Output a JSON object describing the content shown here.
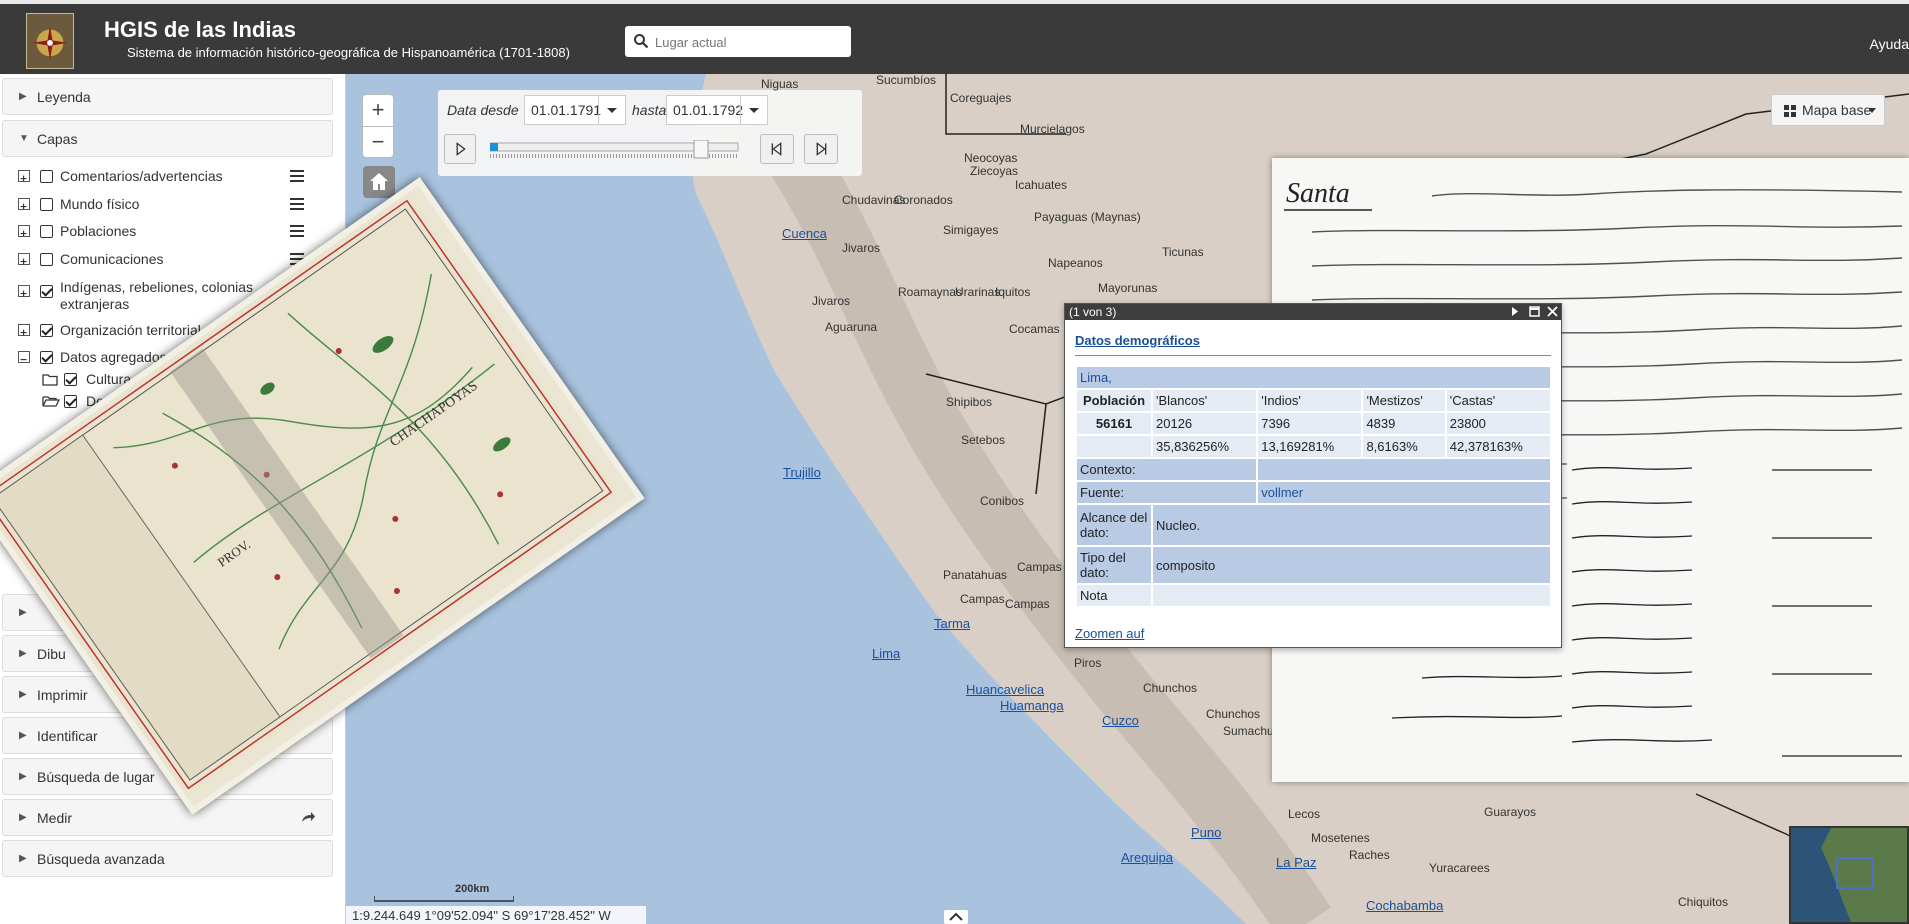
{
  "app": {
    "title": "HGIS de las Indias",
    "subtitle": "Sistema de información histórico-geográfica de Hispanoamérica (1701-1808)",
    "help": "Ayuda"
  },
  "search": {
    "placeholder": "Lugar actual"
  },
  "sidebar": {
    "panels": {
      "legend": "Leyenda",
      "layers": "Capas",
      "identify": "Identificar",
      "place_search": "Búsqueda de lugar",
      "measure": "Medir",
      "advanced_search": "Búsqueda avanzada",
      "draw": "Dibu",
      "print": "Imprimir"
    },
    "layers": [
      {
        "label": "Comentarios/advertencias",
        "checked": false
      },
      {
        "label": "Mundo físico",
        "checked": false
      },
      {
        "label": "Poblaciones",
        "checked": false
      },
      {
        "label": "Comunicaciones",
        "checked": false
      },
      {
        "label": "Indígenas, rebeliones, colonias",
        "label2": "extranjeras",
        "checked": true
      },
      {
        "label": "Organización territorial",
        "checked": true
      },
      {
        "label": "Datos agregados",
        "checked": true
      }
    ],
    "sublayers": [
      {
        "label": "Cultura (grup",
        "checked": true
      },
      {
        "label": "Demog",
        "checked": true
      }
    ]
  },
  "timebar": {
    "from_label": "Data desde",
    "from_value": "01.01.1791",
    "to_label": "hasta",
    "to_value": "01.01.1792"
  },
  "mapbase": {
    "label": "Mapa base"
  },
  "popup": {
    "counter": "(1 von 3)",
    "section": "Datos demográficos",
    "place": "Lima,",
    "headers": [
      "Población",
      "'Blancos'",
      "'Indios'",
      "'Mestizos'",
      "'Castas'"
    ],
    "values": [
      "56161",
      "20126",
      "7396",
      "4839",
      "23800"
    ],
    "percents": [
      "35,836256%",
      "13,169281%",
      "8,6163%",
      "42,378163%"
    ],
    "context_label": "Contexto:",
    "source_label": "Fuente:",
    "source_value": "vollmer",
    "scope_label": "Alcance del dato:",
    "scope_value": "Nucleo.",
    "type_label": "Tipo del dato:",
    "type_value": "composito",
    "note_label": "Nota",
    "zoom_link": "Zoomen auf"
  },
  "map": {
    "scale_label": "200km",
    "coords": "1:9.244.649   1°09'52.094\" S   69°17'28.452\" W",
    "links": [
      "Cuenca",
      "Trujillo",
      "Tarma",
      "Lima",
      "Huancavelica",
      "Huamanga",
      "Cuzco",
      "Puno",
      "Arequipa",
      "La Paz",
      "Cochabamba"
    ],
    "places": [
      "Niguas",
      "Sucumbíos",
      "Coreguajes",
      "Murcielagos",
      "Neocoyas",
      "Ziecoyas",
      "Icahuates",
      "Chudavinas",
      "Coronados",
      "Simigayes",
      "Payaguas (Maynas)",
      "Jivaros",
      "Ticunas",
      "Napeanos",
      "Roamaynas",
      "Urarinas",
      "Iquitos",
      "Mayorunas",
      "Jivaros",
      "Aguaruna",
      "Cocamas",
      "Shipibos",
      "Setebos",
      "Conibos",
      "Panatahuas",
      "Campas",
      "Campas",
      "Campas",
      "Piros",
      "Chunchos",
      "Chunchos",
      "Sumachu",
      "Lecos",
      "Guarayos",
      "Mosetenes",
      "Yuracarees",
      "Raches",
      "Chiquitos"
    ],
    "doc_title": "Santa"
  }
}
